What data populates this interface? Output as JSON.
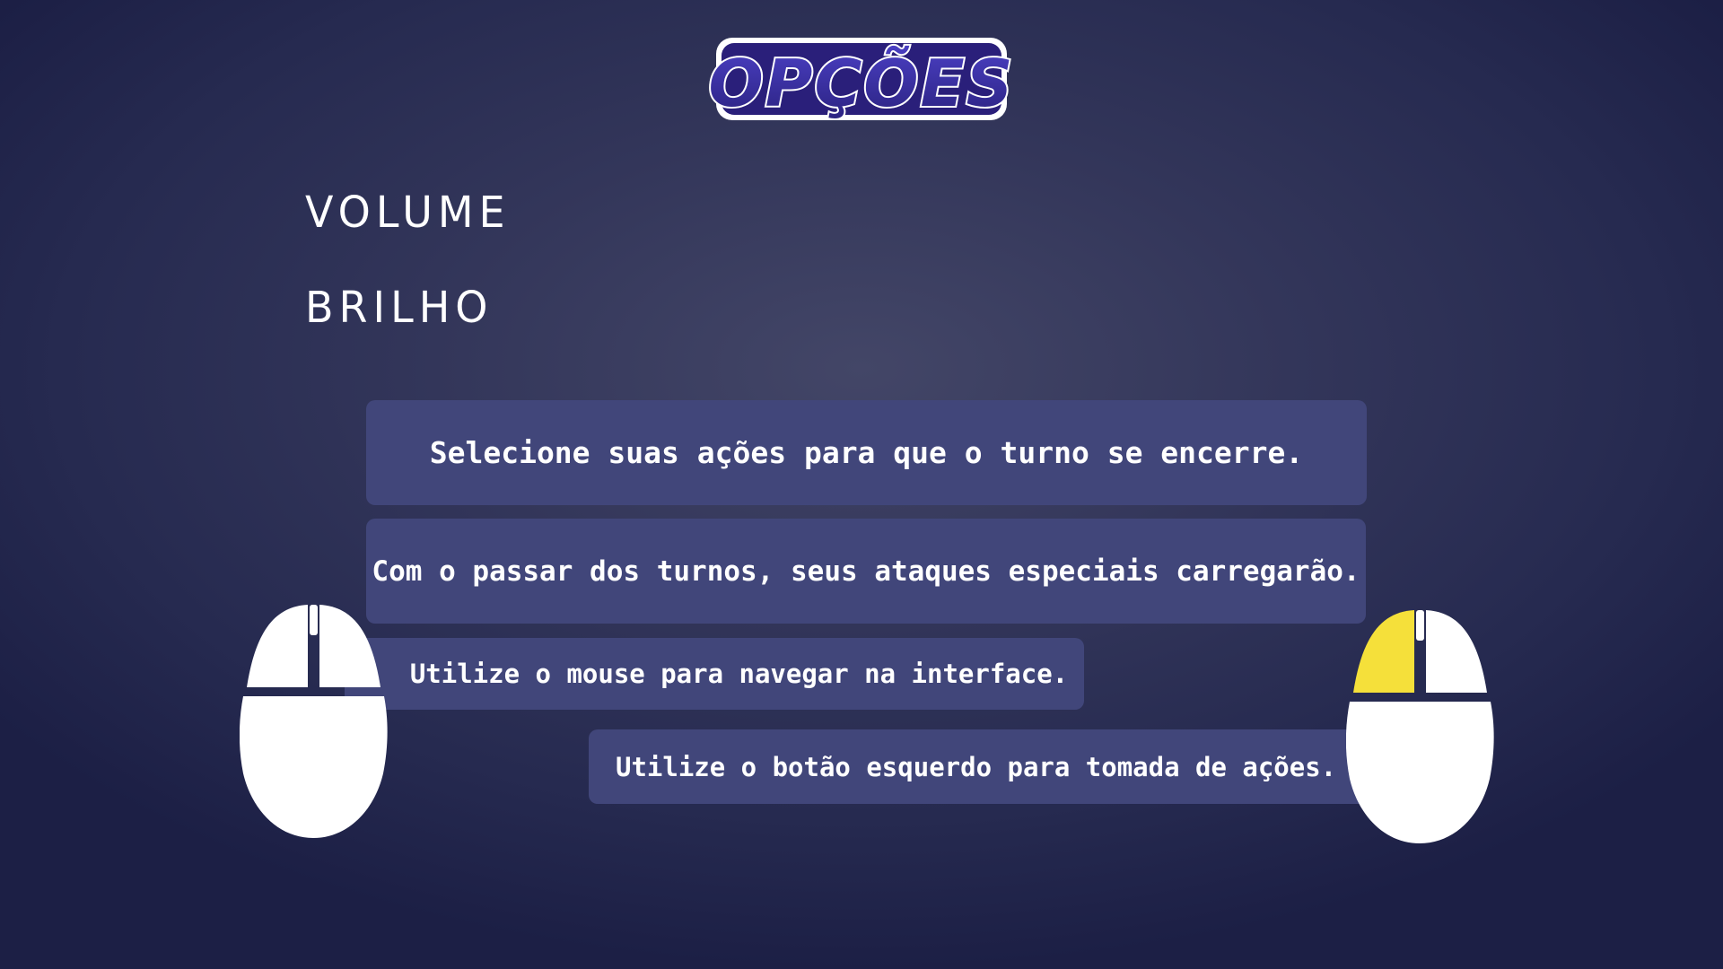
{
  "screen": {
    "title": "OPÇÕES"
  },
  "menu": {
    "volume_label": "VOLUME",
    "brightness_label": "BRILHO"
  },
  "tips": [
    "Selecione suas ações para que o turno se encerre.",
    "Com o passar dos turnos, seus ataques especiais carregarão.",
    "Utilize o mouse para navegar na interface.",
    "Utilize o botão esquerdo para tomada de ações."
  ],
  "icons": {
    "mouse_left": "mouse-icon",
    "mouse_right": "mouse-left-button-highlighted-icon"
  },
  "colors": {
    "background": "#2b2f55",
    "tip_box": "#41467a",
    "text": "#ffffff",
    "logo_fill": "#3b2f9c",
    "highlight": "#f5e03a"
  }
}
